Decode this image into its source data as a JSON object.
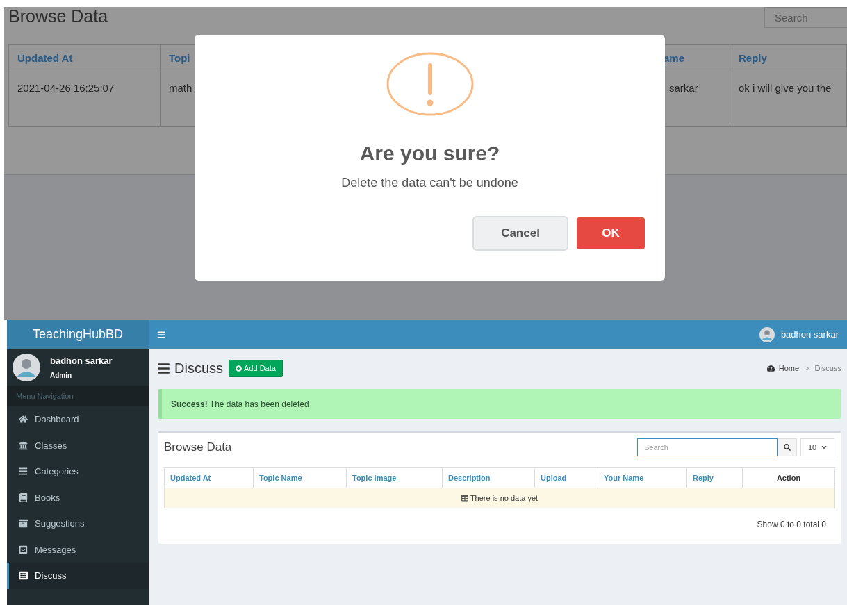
{
  "background_page": {
    "title": "Browse Data",
    "search": {
      "placeholder": "Search"
    },
    "table": {
      "columns": [
        "Updated At",
        "Topi",
        "ame",
        "Reply"
      ],
      "rows": [
        [
          "2021-04-26 16:25:07",
          "math",
          "sarkar",
          "ok i will give you the"
        ]
      ]
    }
  },
  "dialog": {
    "title": "Are you sure?",
    "message": "Delete the data can't be undone",
    "buttons": [
      {
        "label": "Cancel",
        "kind": "cancel"
      },
      {
        "label": "OK",
        "kind": "confirm"
      }
    ]
  },
  "app": {
    "brand": "TeachingHubBD",
    "user": {
      "name": "badhon sarkar",
      "role": "Admin"
    },
    "topbar_user": "badhon sarkar",
    "sidebar": {
      "heading": "Menu Navigation",
      "items": [
        {
          "label": "Dashboard",
          "selected": false
        },
        {
          "label": "Classes",
          "selected": false
        },
        {
          "label": "Categories",
          "selected": false
        },
        {
          "label": "Books",
          "selected": false
        },
        {
          "label": "Suggestions",
          "selected": false
        },
        {
          "label": "Messages",
          "selected": false
        },
        {
          "label": "Discuss",
          "selected": true
        }
      ]
    },
    "page": {
      "title": "Discuss",
      "add_button": "Add Data",
      "breadcrumb": [
        "Home",
        "Discuss"
      ],
      "breadcrumb_separator": ">"
    },
    "alert": "**Success!** The data has been deleted",
    "box": {
      "title": "Browse Data",
      "search": {
        "placeholder": "Search"
      },
      "page_size": "10",
      "columns": [
        {
          "label": "Updated At",
          "sortable": true
        },
        {
          "label": "Topic Name",
          "sortable": true
        },
        {
          "label": "Topic Image",
          "sortable": true
        },
        {
          "label": "Description",
          "sortable": true
        },
        {
          "label": "Upload",
          "sortable": true
        },
        {
          "label": "Your Name",
          "sortable": true
        },
        {
          "label": "Reply",
          "sortable": true
        },
        {
          "label": "Action",
          "sortable": false
        }
      ],
      "empty": "There is no data yet",
      "footer": "Show 0 to 0 total 0"
    }
  }
}
